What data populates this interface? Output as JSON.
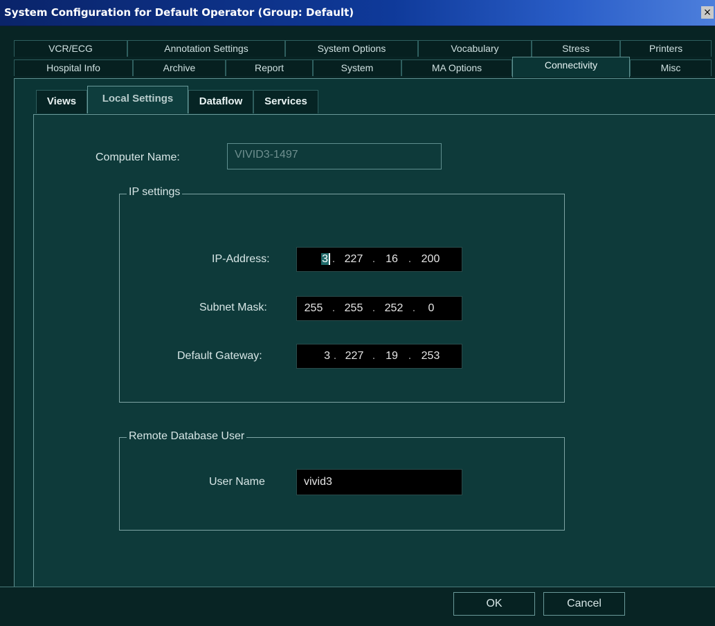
{
  "window": {
    "title": "System Configuration for Default Operator (Group: Default)",
    "close": "×"
  },
  "tabs": {
    "row1": [
      "VCR/ECG",
      "Annotation Settings",
      "System Options",
      "Vocabulary",
      "Stress",
      "Printers"
    ],
    "row2": [
      "Hospital Info",
      "Archive",
      "Report",
      "System",
      "MA Options",
      "Connectivity",
      "Misc"
    ],
    "active": "Connectivity"
  },
  "subtabs": {
    "items": [
      "Views",
      "Local Settings",
      "Dataflow",
      "Services"
    ],
    "active": "Local Settings"
  },
  "computer": {
    "label": "Computer Name:",
    "value": "VIVID3-1497"
  },
  "ip_settings": {
    "legend": "IP settings",
    "ip_address": {
      "label": "IP-Address:",
      "octets": [
        "3",
        "227",
        "16",
        "200"
      ]
    },
    "subnet_mask": {
      "label": "Subnet Mask:",
      "octets": [
        "255",
        "255",
        "252",
        "0"
      ]
    },
    "default_gateway": {
      "label": "Default Gateway:",
      "octets": [
        "3",
        "227",
        "19",
        "253"
      ]
    },
    "separator": "."
  },
  "remote_db": {
    "legend": "Remote Database User",
    "user_label": "User Name",
    "user_value": "vivid3"
  },
  "buttons": {
    "ok": "OK",
    "cancel": "Cancel"
  }
}
